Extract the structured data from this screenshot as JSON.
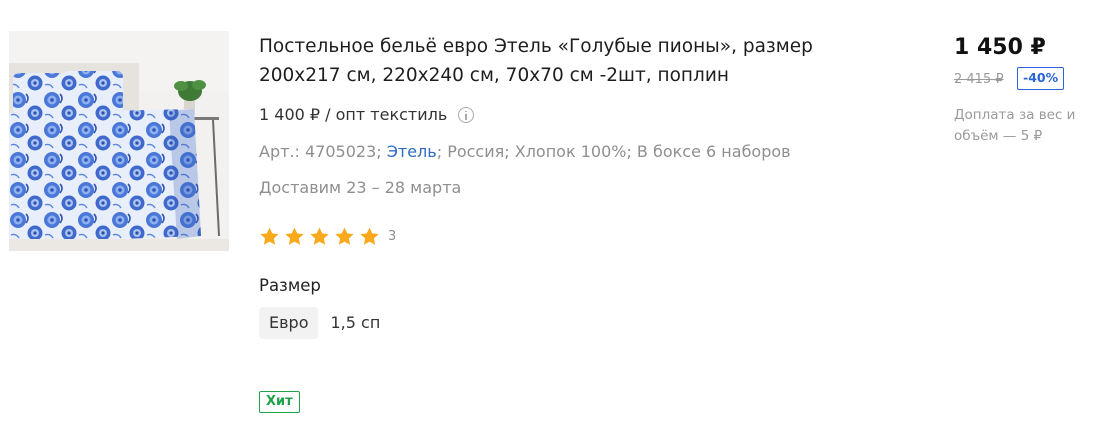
{
  "product": {
    "title": "Постельное бельё евро Этель «Голубые пионы», размер 200х217 см, 220х240 см, 70х70 см -2шт, поплин",
    "image_alt": "bedding-photo",
    "wholesale_price": "1 400 ₽ / опт текстиль",
    "attributes": {
      "prefix": "Арт.: 4705023; ",
      "brand": "Этель",
      "suffix": "; Россия; Хлопок 100%; В боксе 6 наборов"
    },
    "delivery": "Доставим 23 – 28 марта",
    "rating": {
      "stars": 5,
      "max": 5,
      "reviews": "3"
    },
    "size": {
      "label": "Размер",
      "options": [
        {
          "label": "Евро",
          "selected": true
        },
        {
          "label": "1,5 сп",
          "selected": false
        }
      ]
    },
    "badge": "Хит"
  },
  "pricing": {
    "price": "1 450 ₽",
    "old_price": "2 415 ₽",
    "discount": "-40%",
    "surcharge": "Доплата за вес и объём — 5 ₽"
  },
  "colors": {
    "star": "#f9a91b",
    "brand_link": "#2f6bc2",
    "discount": "#2a64d6",
    "hit_badge": "#1fa24a"
  },
  "icons": {
    "info": "info-circle-icon",
    "star": "star-icon"
  }
}
